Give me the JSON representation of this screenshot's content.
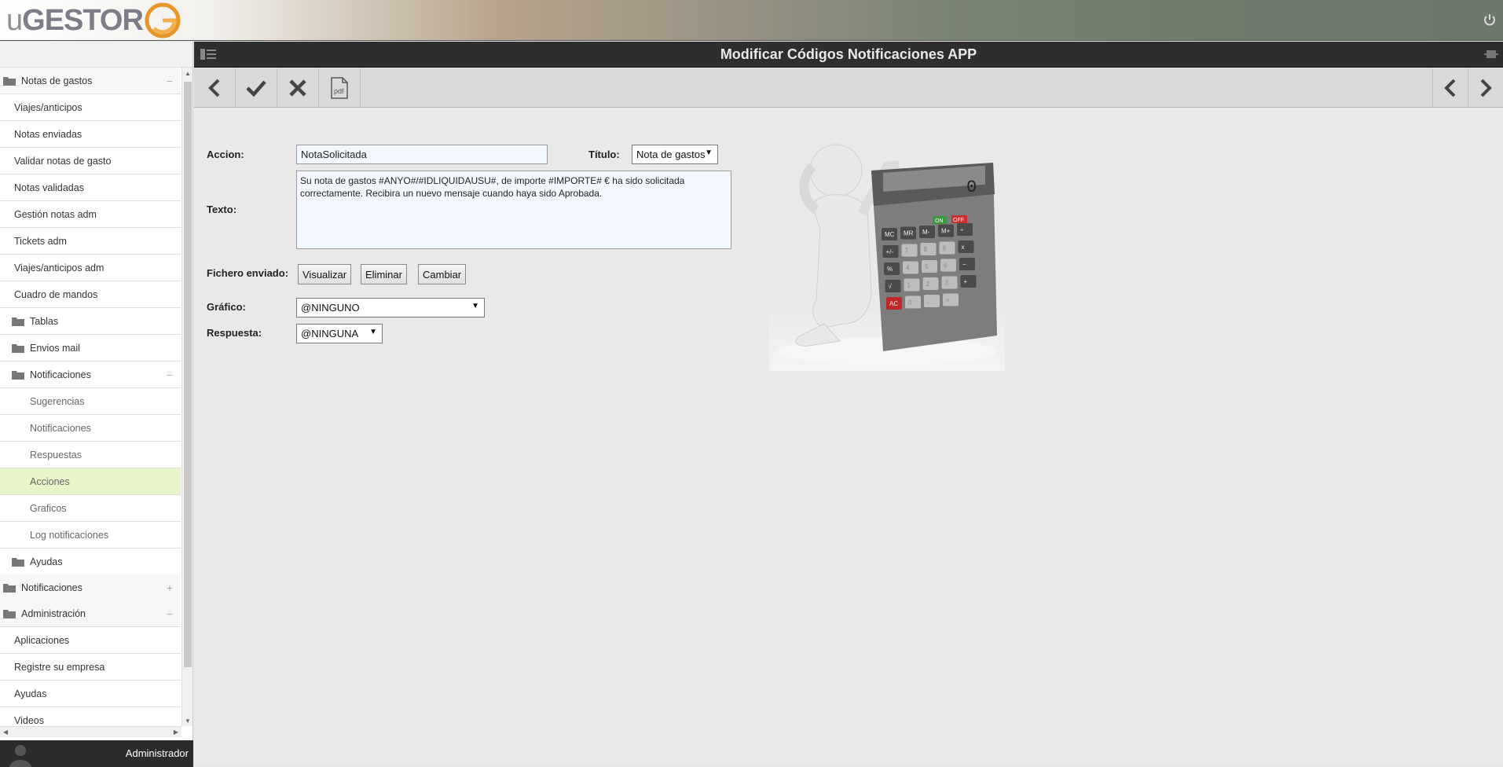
{
  "app": {
    "logo_text_thin": "u",
    "logo_text_bold": "GESTOR"
  },
  "header": {
    "title": "Modificar Códigos Notificaciones APP"
  },
  "sidebar": {
    "items": [
      {
        "label": "Notas de gastos",
        "type": "folder",
        "sign": "−"
      },
      {
        "label": "Viajes/anticipos",
        "type": "link"
      },
      {
        "label": "Notas enviadas",
        "type": "link"
      },
      {
        "label": "Validar notas de gasto",
        "type": "link"
      },
      {
        "label": "Notas validadas",
        "type": "link"
      },
      {
        "label": "Gestión notas adm",
        "type": "link"
      },
      {
        "label": "Tickets adm",
        "type": "link"
      },
      {
        "label": "Viajes/anticipos adm",
        "type": "link"
      },
      {
        "label": "Cuadro de mandos",
        "type": "link"
      },
      {
        "label": "Tablas",
        "type": "subfolder"
      },
      {
        "label": "Envios mail",
        "type": "subfolder"
      },
      {
        "label": "Notificaciones",
        "type": "subfolder",
        "sign": "−"
      },
      {
        "label": "Sugerencias",
        "type": "sublink"
      },
      {
        "label": "Notificaciones",
        "type": "sublink"
      },
      {
        "label": "Respuestas",
        "type": "sublink"
      },
      {
        "label": "Acciones",
        "type": "sublink",
        "active": true
      },
      {
        "label": "Graficos",
        "type": "sublink"
      },
      {
        "label": "Log notificaciones",
        "type": "sublink"
      },
      {
        "label": "Ayudas",
        "type": "subfolder"
      },
      {
        "label": "Notificaciones",
        "type": "folder",
        "sign": "+"
      },
      {
        "label": "Administración",
        "type": "folder",
        "sign": "−"
      },
      {
        "label": "Aplicaciones",
        "type": "link"
      },
      {
        "label": "Registre su empresa",
        "type": "link"
      },
      {
        "label": "Ayudas",
        "type": "link"
      },
      {
        "label": "Videos",
        "type": "link"
      }
    ]
  },
  "user": {
    "name": "Administrador"
  },
  "toolbar": {
    "left_buttons": [
      "back-icon",
      "check-icon",
      "close-icon",
      "pdf-icon"
    ],
    "right_buttons": [
      "previous-icon",
      "next-icon"
    ],
    "pdf_label": "pdf"
  },
  "form": {
    "accion_label": "Accion:",
    "accion_value": "NotaSolicitada",
    "titulo_label": "Título:",
    "titulo_value": "Nota de gastos",
    "texto_label": "Texto:",
    "texto_value": "Su nota de gastos #ANYO#/#IDLIQUIDAUSU#, de importe #IMPORTE# € ha sido solicitada correctamente. Recibira un nuevo mensaje cuando haya sido Aprobada.",
    "fichero_label": "Fichero enviado:",
    "visualizar": "Visualizar",
    "eliminar": "Eliminar",
    "cambiar": "Cambiar",
    "grafico_label": "Gráfico:",
    "grafico_value": "@NINGUNO",
    "respuesta_label": "Respuesta:",
    "respuesta_value": "@NINGUNA"
  },
  "calculator": {
    "display": "0",
    "on": "ON",
    "off": "OFF",
    "keys_row1": [
      "MC",
      "MR",
      "M-",
      "M+",
      "÷"
    ],
    "keys_row2": [
      "+/-",
      "7",
      "8",
      "9",
      "x"
    ],
    "keys_row3": [
      "%",
      "4",
      "5",
      "6",
      "−"
    ],
    "keys_row4": [
      "√",
      "1",
      "2",
      "3",
      "+"
    ],
    "keys_row5": [
      "AC",
      "0",
      ".",
      "="
    ]
  }
}
